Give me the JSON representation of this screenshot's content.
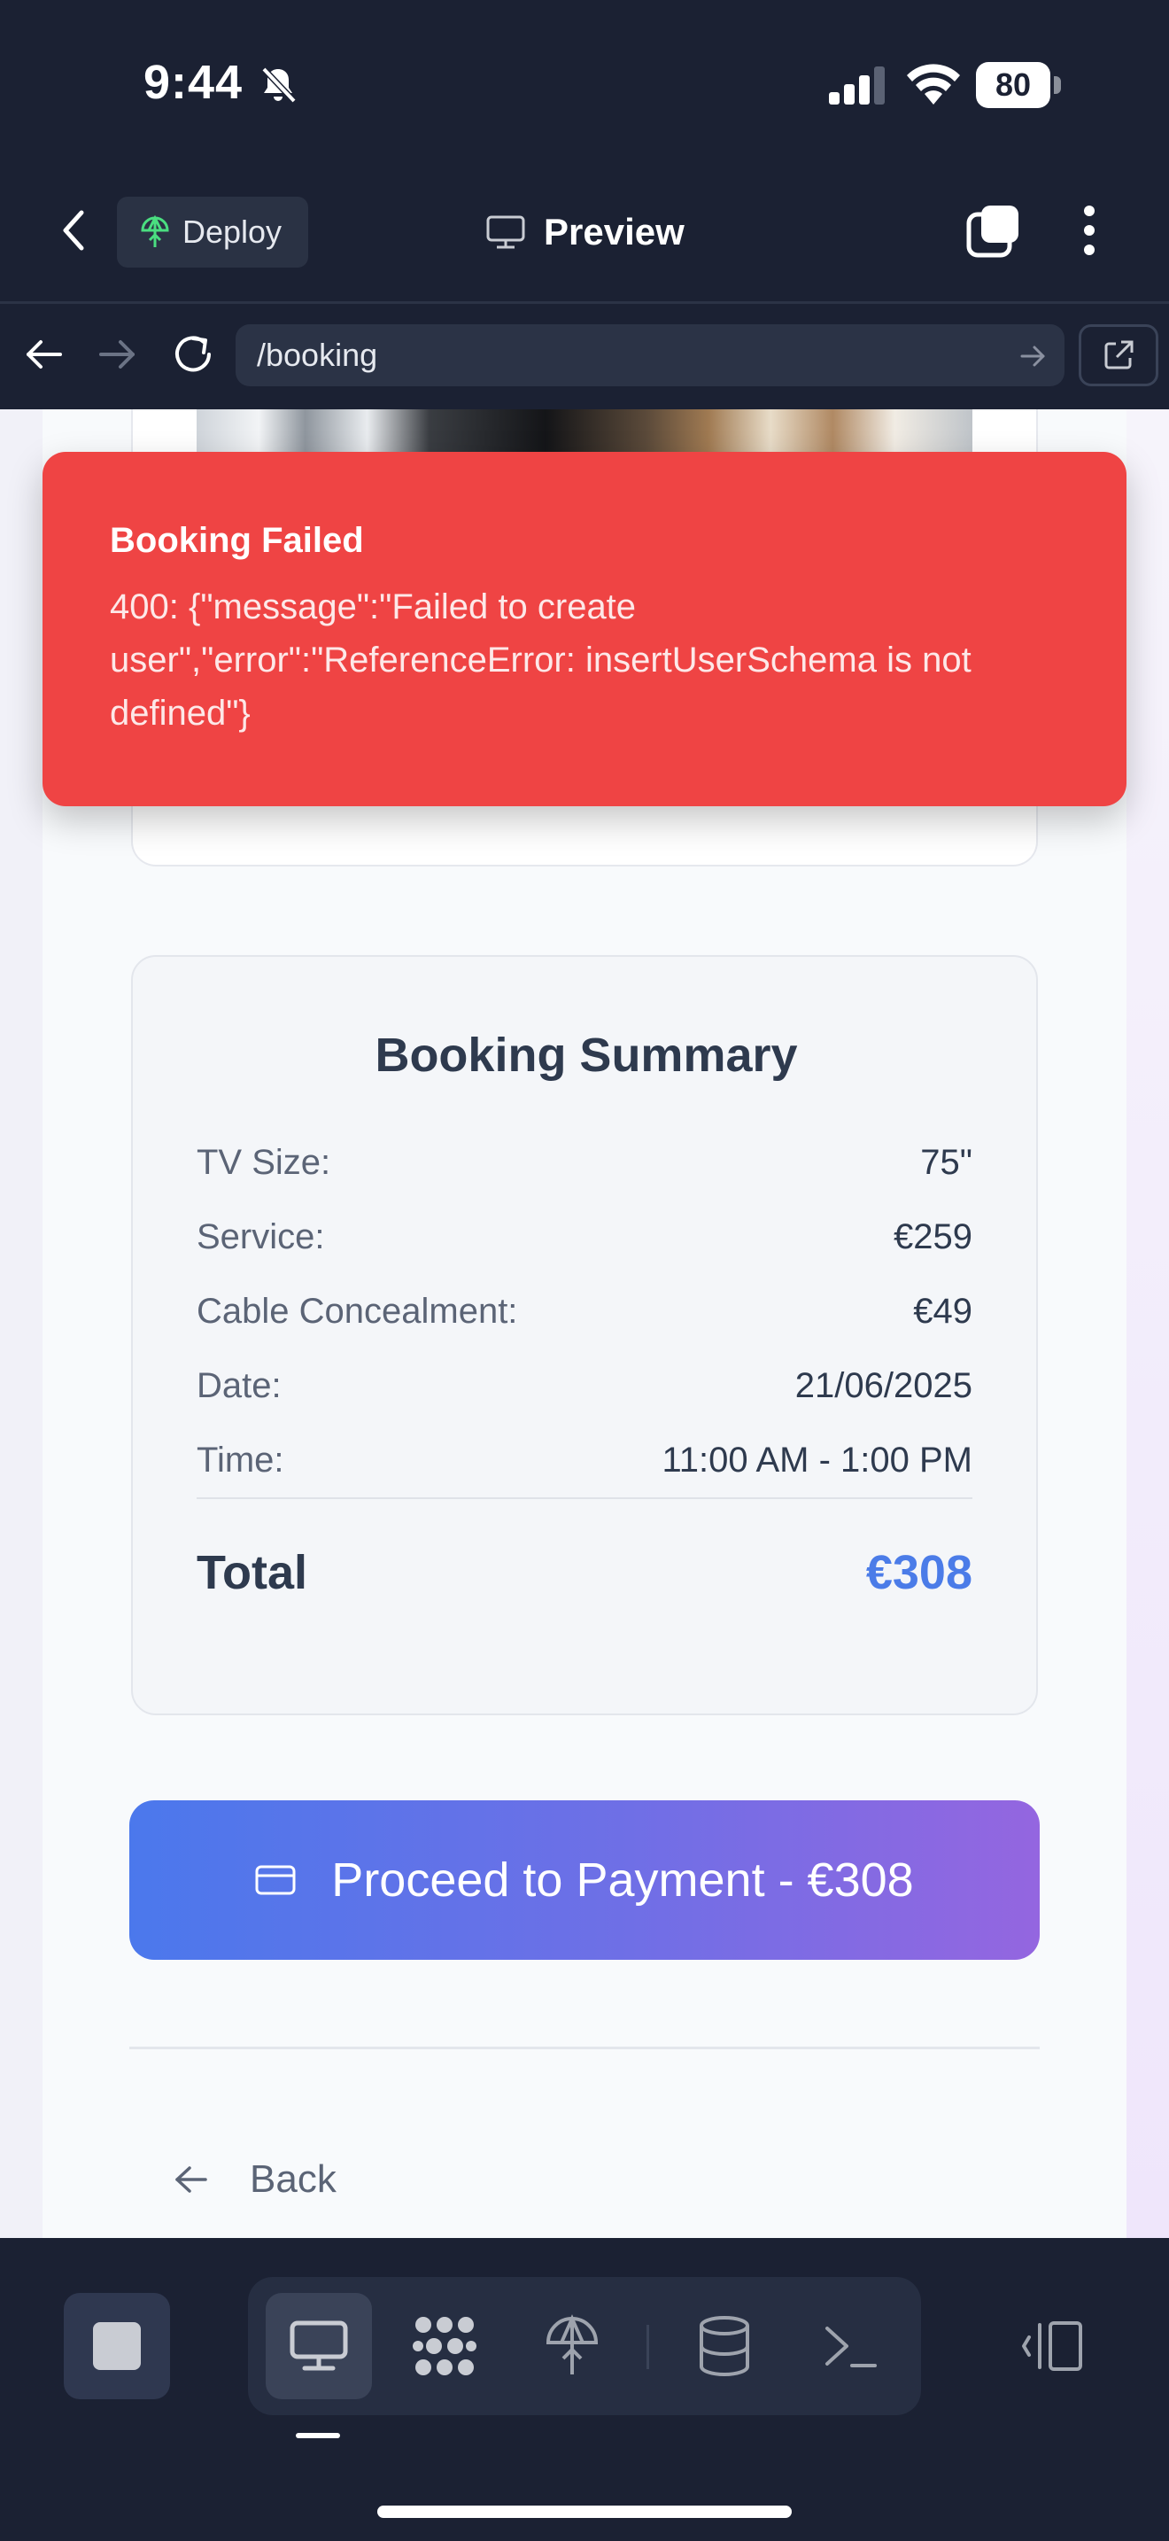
{
  "status_bar": {
    "time": "9:44",
    "battery": "80"
  },
  "toolbar": {
    "deploy_label": "Deploy",
    "preview_label": "Preview"
  },
  "browser": {
    "url": "/booking"
  },
  "toast": {
    "title": "Booking Failed",
    "message": "400: {\"message\":\"Failed to create user\",\"error\":\"ReferenceError: insertUserSchema is not defined\"}"
  },
  "summary": {
    "title": "Booking Summary",
    "rows": [
      {
        "label": "TV Size:",
        "value": "75\""
      },
      {
        "label": "Service:",
        "value": "€259"
      },
      {
        "label": "Cable Concealment:",
        "value": "€49"
      },
      {
        "label": "Date:",
        "value": "21/06/2025"
      },
      {
        "label": "Time:",
        "value": "11:00 AM - 1:00 PM"
      }
    ],
    "total_label": "Total",
    "total_value": "€308"
  },
  "payment_button_label": "Proceed to Payment - €308",
  "back_label": "Back",
  "colors": {
    "toast_bg": "#ef4444",
    "accent_blue": "#4b7ce8",
    "button_gradient_start": "#4b78ec",
    "button_gradient_end": "#9466e0",
    "chrome_bg": "#1b2133"
  },
  "bottom_tools": [
    {
      "icon": "monitor-icon",
      "active": true
    },
    {
      "icon": "agent-icon",
      "active": false
    },
    {
      "icon": "deploy-icon",
      "active": false
    },
    {
      "icon": "database-icon",
      "active": false
    },
    {
      "icon": "terminal-icon",
      "active": false
    }
  ]
}
